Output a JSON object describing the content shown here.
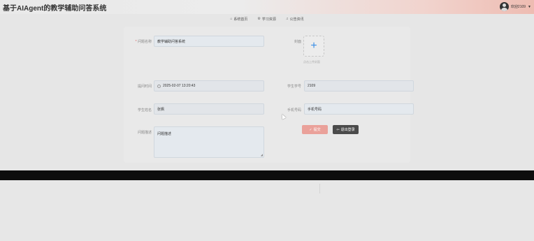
{
  "header": {
    "app_title": "基于AIAgent的教学辅助问答系统",
    "user_label": "欢迎2109"
  },
  "nav": {
    "items": [
      {
        "label": "系统首页",
        "icon": "home-icon"
      },
      {
        "label": "学习资源",
        "icon": "gear-icon"
      },
      {
        "label": "公告资讯",
        "icon": "bell-icon"
      }
    ]
  },
  "form": {
    "question_name_label": "问题名称",
    "question_name_value": "教学辅助问答系统",
    "cover_label": "封面",
    "upload_hint": "点击上传封面",
    "submit_time_label": "提问时间",
    "submit_time_value": "2025-02-07 13:20:43",
    "student_id_label": "学生学号",
    "student_id_value": "2109",
    "student_name_label": "学生姓名",
    "student_name_value": "张枫",
    "phone_label": "手机号码",
    "phone_value": "手机号码",
    "desc_label": "问题描述",
    "desc_value": "问题描述",
    "submit_button": "提交",
    "back_button": "退出登录"
  },
  "colors": {
    "accent": "#3a8ee6",
    "submit_button": "#eaa19a",
    "back_button": "#4b4b4b",
    "header_gradient_end": "#eebcb2"
  }
}
